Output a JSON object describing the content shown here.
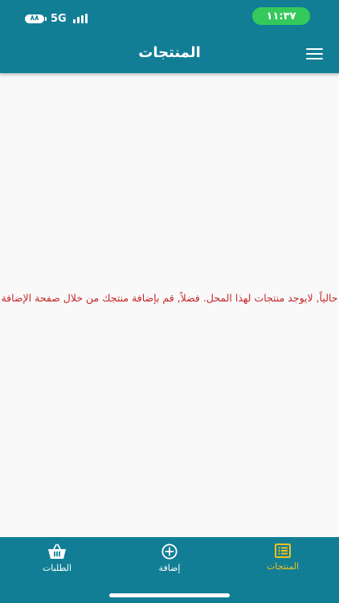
{
  "status_bar": {
    "battery": "٨٨",
    "network": "5G",
    "time": "١١:٣٧"
  },
  "header": {
    "title": "المنتجات"
  },
  "main": {
    "empty_message": "حالياً, لايوجد منتجات لهذا المحل. فضلاً, قم بإضافة منتجك من خلال صفحة الإضافة"
  },
  "bottom_nav": {
    "items": [
      {
        "label": "الطلبات",
        "icon": "basket-icon"
      },
      {
        "label": "إضافة",
        "icon": "plus-circle-icon"
      },
      {
        "label": "المنتجات",
        "icon": "list-icon",
        "active": true
      }
    ]
  },
  "colors": {
    "primary": "#127e96",
    "active_tab": "#f2c11b",
    "error_text": "#c62828",
    "time_pill": "#34c95a"
  }
}
